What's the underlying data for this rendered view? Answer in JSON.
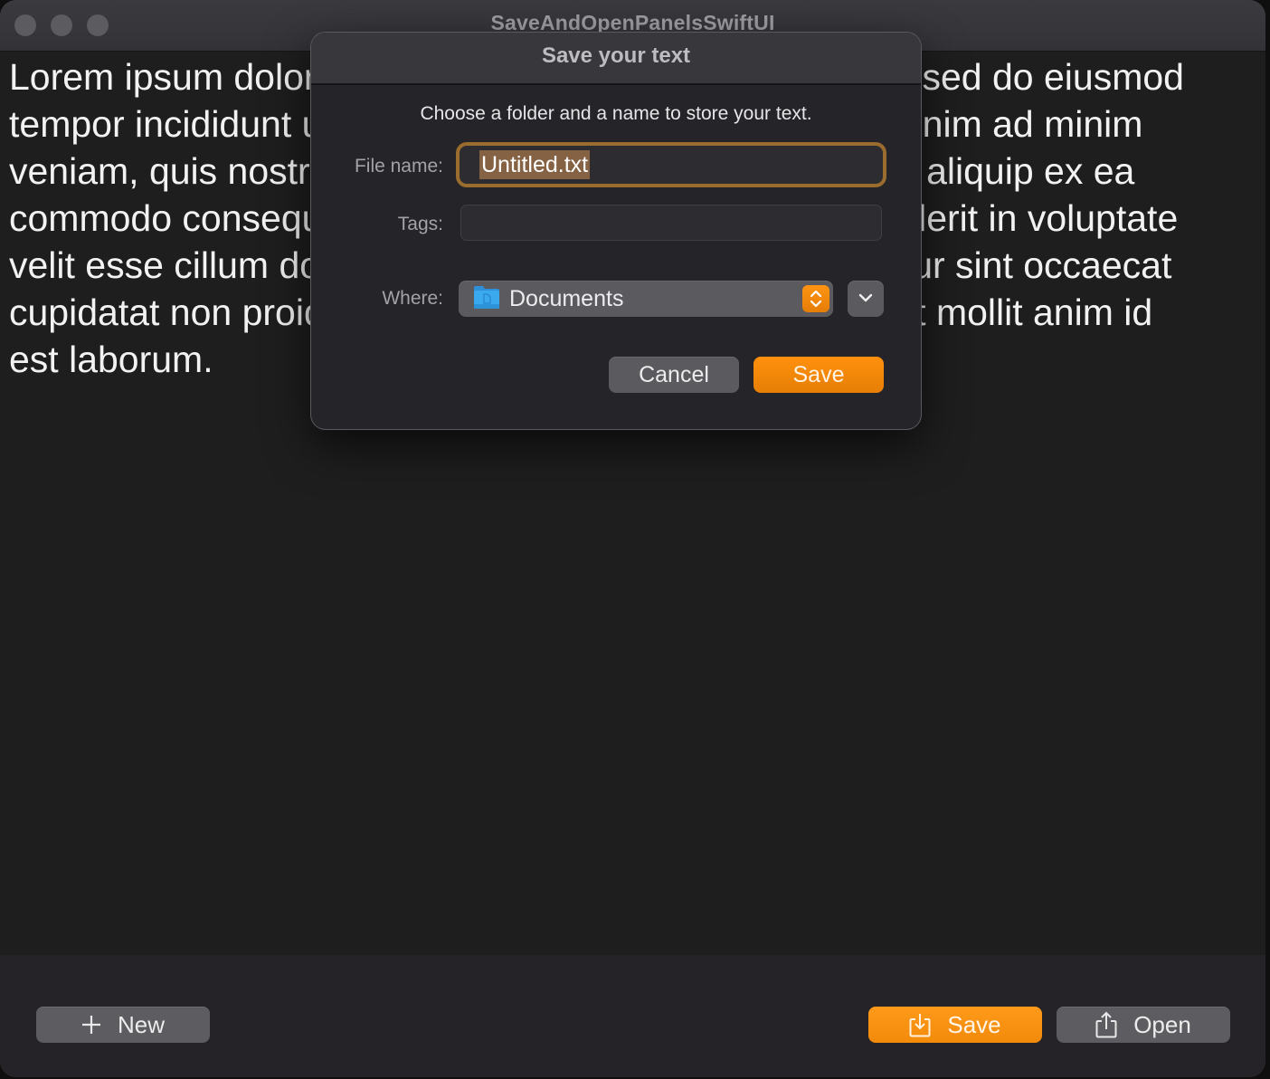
{
  "window": {
    "title": "SaveAndOpenPanelsSwiftUI"
  },
  "editor": {
    "text": "Lorem ipsum dolor sit amet, consectetur adipiscing elit, sed do eiusmod tempor incididunt ut labore et dolore magna aliqua. Ut enim ad minim veniam, quis nostrud exercitation ullamco laboris nisi ut aliquip ex ea commodo consequat. Duis aute irure dolor in reprehenderit in voluptate velit esse cillum dolore eu fugiat nulla pariatur. Excepteur sint occaecat cupidatat non proident, sunt in culpa qui officia deserunt mollit anim id est laborum.",
    "visible_lines": [
      "Lorem ipsum dolor sit amet, consectetur adipiscing elit, sed do eiusmod",
      "tempor incididunt ut labore et dolore magna aliqua. Ut enim ad minim",
      "veniam, quis nostrud exercitation ullamco laboris nisi ut aliquip ex ea",
      "commodo consequat. Duis aute irure dolor in reprehenderit in voluptate",
      "velit esse cillum dolore eu fugiat nulla pariatur. Excepteur sint occaecat",
      "cupidatat non proident, sunt in culpa qui officia deserunt mollit anim id",
      "est laborum."
    ]
  },
  "toolbar": {
    "new_label": "New",
    "new_icon": "plus-icon",
    "save_label": "Save",
    "save_icon": "download-tray-icon",
    "open_label": "Open",
    "open_icon": "share-upload-icon"
  },
  "save_sheet": {
    "title": "Save your text",
    "message": "Choose a folder and a name to store your text.",
    "file_name_label": "File name:",
    "file_name_value": "Untitled.txt",
    "tags_label": "Tags:",
    "tags_value": "",
    "where_label": "Where:",
    "where_value": "Documents",
    "where_icon": "documents-folder-icon",
    "cancel_label": "Cancel",
    "save_label": "Save"
  },
  "colors": {
    "accent": "#FF9212",
    "focus_ring": "#9A6C2E",
    "selection": "#866245",
    "folder_blue": "#3AA9EE"
  }
}
